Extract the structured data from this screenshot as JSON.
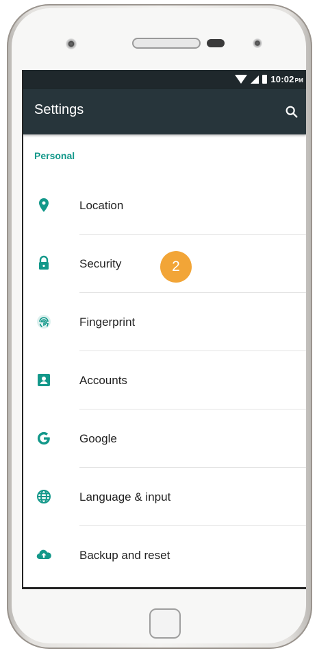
{
  "status_bar": {
    "time": "10:02",
    "ampm": "PM"
  },
  "app_bar": {
    "title": "Settings"
  },
  "section": {
    "header": "Personal"
  },
  "settings_items": [
    {
      "label": "Location",
      "icon": "location-pin-icon"
    },
    {
      "label": "Security",
      "icon": "lock-icon"
    },
    {
      "label": "Fingerprint",
      "icon": "fingerprint-icon"
    },
    {
      "label": "Accounts",
      "icon": "account-icon"
    },
    {
      "label": "Google",
      "icon": "google-icon"
    },
    {
      "label": "Language & input",
      "icon": "globe-icon"
    },
    {
      "label": "Backup and reset",
      "icon": "cloud-upload-icon"
    }
  ],
  "step_badge": {
    "number": "2"
  },
  "colors": {
    "accent": "#13988a",
    "app_bar": "#27353b",
    "status_bar": "#1f282c",
    "badge": "#f2a537"
  }
}
